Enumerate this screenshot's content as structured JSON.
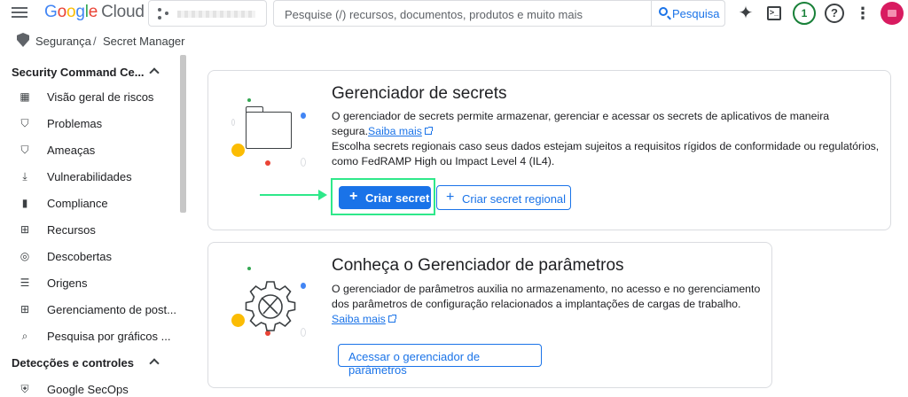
{
  "topbar": {
    "logo_g": "G",
    "logo_o1": "o",
    "logo_o2": "o",
    "logo_g2": "g",
    "logo_l": "l",
    "logo_e": "e",
    "logo_product": "Cloud",
    "search_placeholder": "Pesquise (/) recursos, documentos, produtos e muito mais",
    "search_button": "Pesquisa",
    "notification_count": "1",
    "help_glyph": "?",
    "term_glyph": ">_"
  },
  "breadcrumb": {
    "section": "Segurança",
    "separator": "/",
    "page": "Secret Manager"
  },
  "sidebar": {
    "section1": "Security Command Ce...",
    "items1": [
      {
        "label": "Visão geral de riscos",
        "icon": "dashboard-icon"
      },
      {
        "label": "Problemas",
        "icon": "shield-alert-icon"
      },
      {
        "label": "Ameaças",
        "icon": "shield-alert-icon"
      },
      {
        "label": "Vulnerabilidades",
        "icon": "download-icon"
      },
      {
        "label": "Compliance",
        "icon": "bar-chart-icon"
      },
      {
        "label": "Recursos",
        "icon": "hierarchy-icon"
      },
      {
        "label": "Descobertas",
        "icon": "radar-icon"
      },
      {
        "label": "Origens",
        "icon": "list-icon"
      },
      {
        "label": "Gerenciamento de post...",
        "icon": "grid-icon"
      },
      {
        "label": "Pesquisa por gráficos ...",
        "icon": "graph-search-icon"
      }
    ],
    "section2": "Detecções e controles",
    "items2": [
      {
        "label": "Google SecOps",
        "icon": "secops-shield-icon"
      }
    ]
  },
  "card1": {
    "title": "Gerenciador de secrets",
    "line1": "O gerenciador de secrets permite armazenar, gerenciar e acessar os secrets de aplicativos de maneira",
    "line2_prefix": "segura.",
    "learn_more": "Saiba mais",
    "line3": "Escolha secrets regionais caso seus dados estejam sujeitos a requisitos rígidos de conformidade ou regulatórios,",
    "line4": "como FedRAMP High ou Impact Level 4 (IL4).",
    "create_button": "Criar secret",
    "create_regional_button": "Criar secret regional"
  },
  "card2": {
    "title": "Conheça o Gerenciador de parâmetros",
    "line1": "O gerenciador de parâmetros auxilia no armazenamento, no acesso e no gerenciamento",
    "line2": "dos parâmetros de configuração relacionados a implantações de cargas de trabalho.",
    "learn_more": "Saiba mais",
    "access_button": "Acessar o gerenciador de parâmetros"
  },
  "colors": {
    "primary": "#1a73e8",
    "highlight": "#2ee88a",
    "avatar": "#d81b60"
  }
}
